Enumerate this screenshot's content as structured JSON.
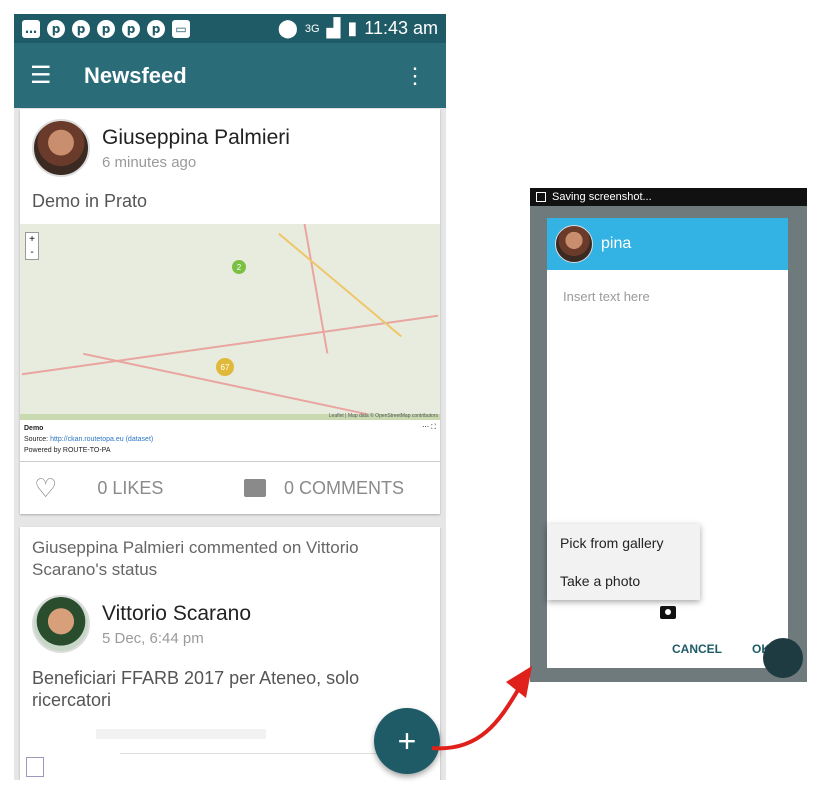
{
  "status_bar": {
    "time": "11:43 am",
    "network": "3G"
  },
  "app_bar": {
    "title": "Newsfeed"
  },
  "posts": [
    {
      "author": "Giuseppina Palmieri",
      "time": "6 minutes ago",
      "text": "Demo in Prato",
      "map": {
        "title": "Demo",
        "source_label": "Source:",
        "source_url": "http://ckan.routetopa.eu",
        "dataset_label": "(dataset)",
        "powered_by": "Powered by ROUTE-TO-PA",
        "clusters": [
          "2",
          "67"
        ],
        "attribution": "Leaflet | Map data © OpenStreetMap contributors"
      },
      "likes": "0 LIKES",
      "comments": "0 COMMENTS"
    },
    {
      "activity": "Giuseppina Palmieri commented on Vittorio Scarano's status",
      "author": "Vittorio Scarano",
      "time": "5 Dec, 6:44 pm",
      "text": "Beneficiari FFARB 2017 per Ateneo, solo ricercatori"
    }
  ],
  "fab": {
    "label": "+"
  },
  "screenshot_phone": {
    "status": "Saving screenshot...",
    "dialog": {
      "user": "pina",
      "placeholder": "Insert text here",
      "menu": [
        "Pick from gallery",
        "Take a photo"
      ],
      "cancel": "CANCEL",
      "ok": "OK"
    }
  },
  "colors": {
    "primary": "#2a6c78",
    "primary_dark": "#1e5b67",
    "dialog_header": "#33b2e4",
    "arrow": "#e0201b"
  }
}
